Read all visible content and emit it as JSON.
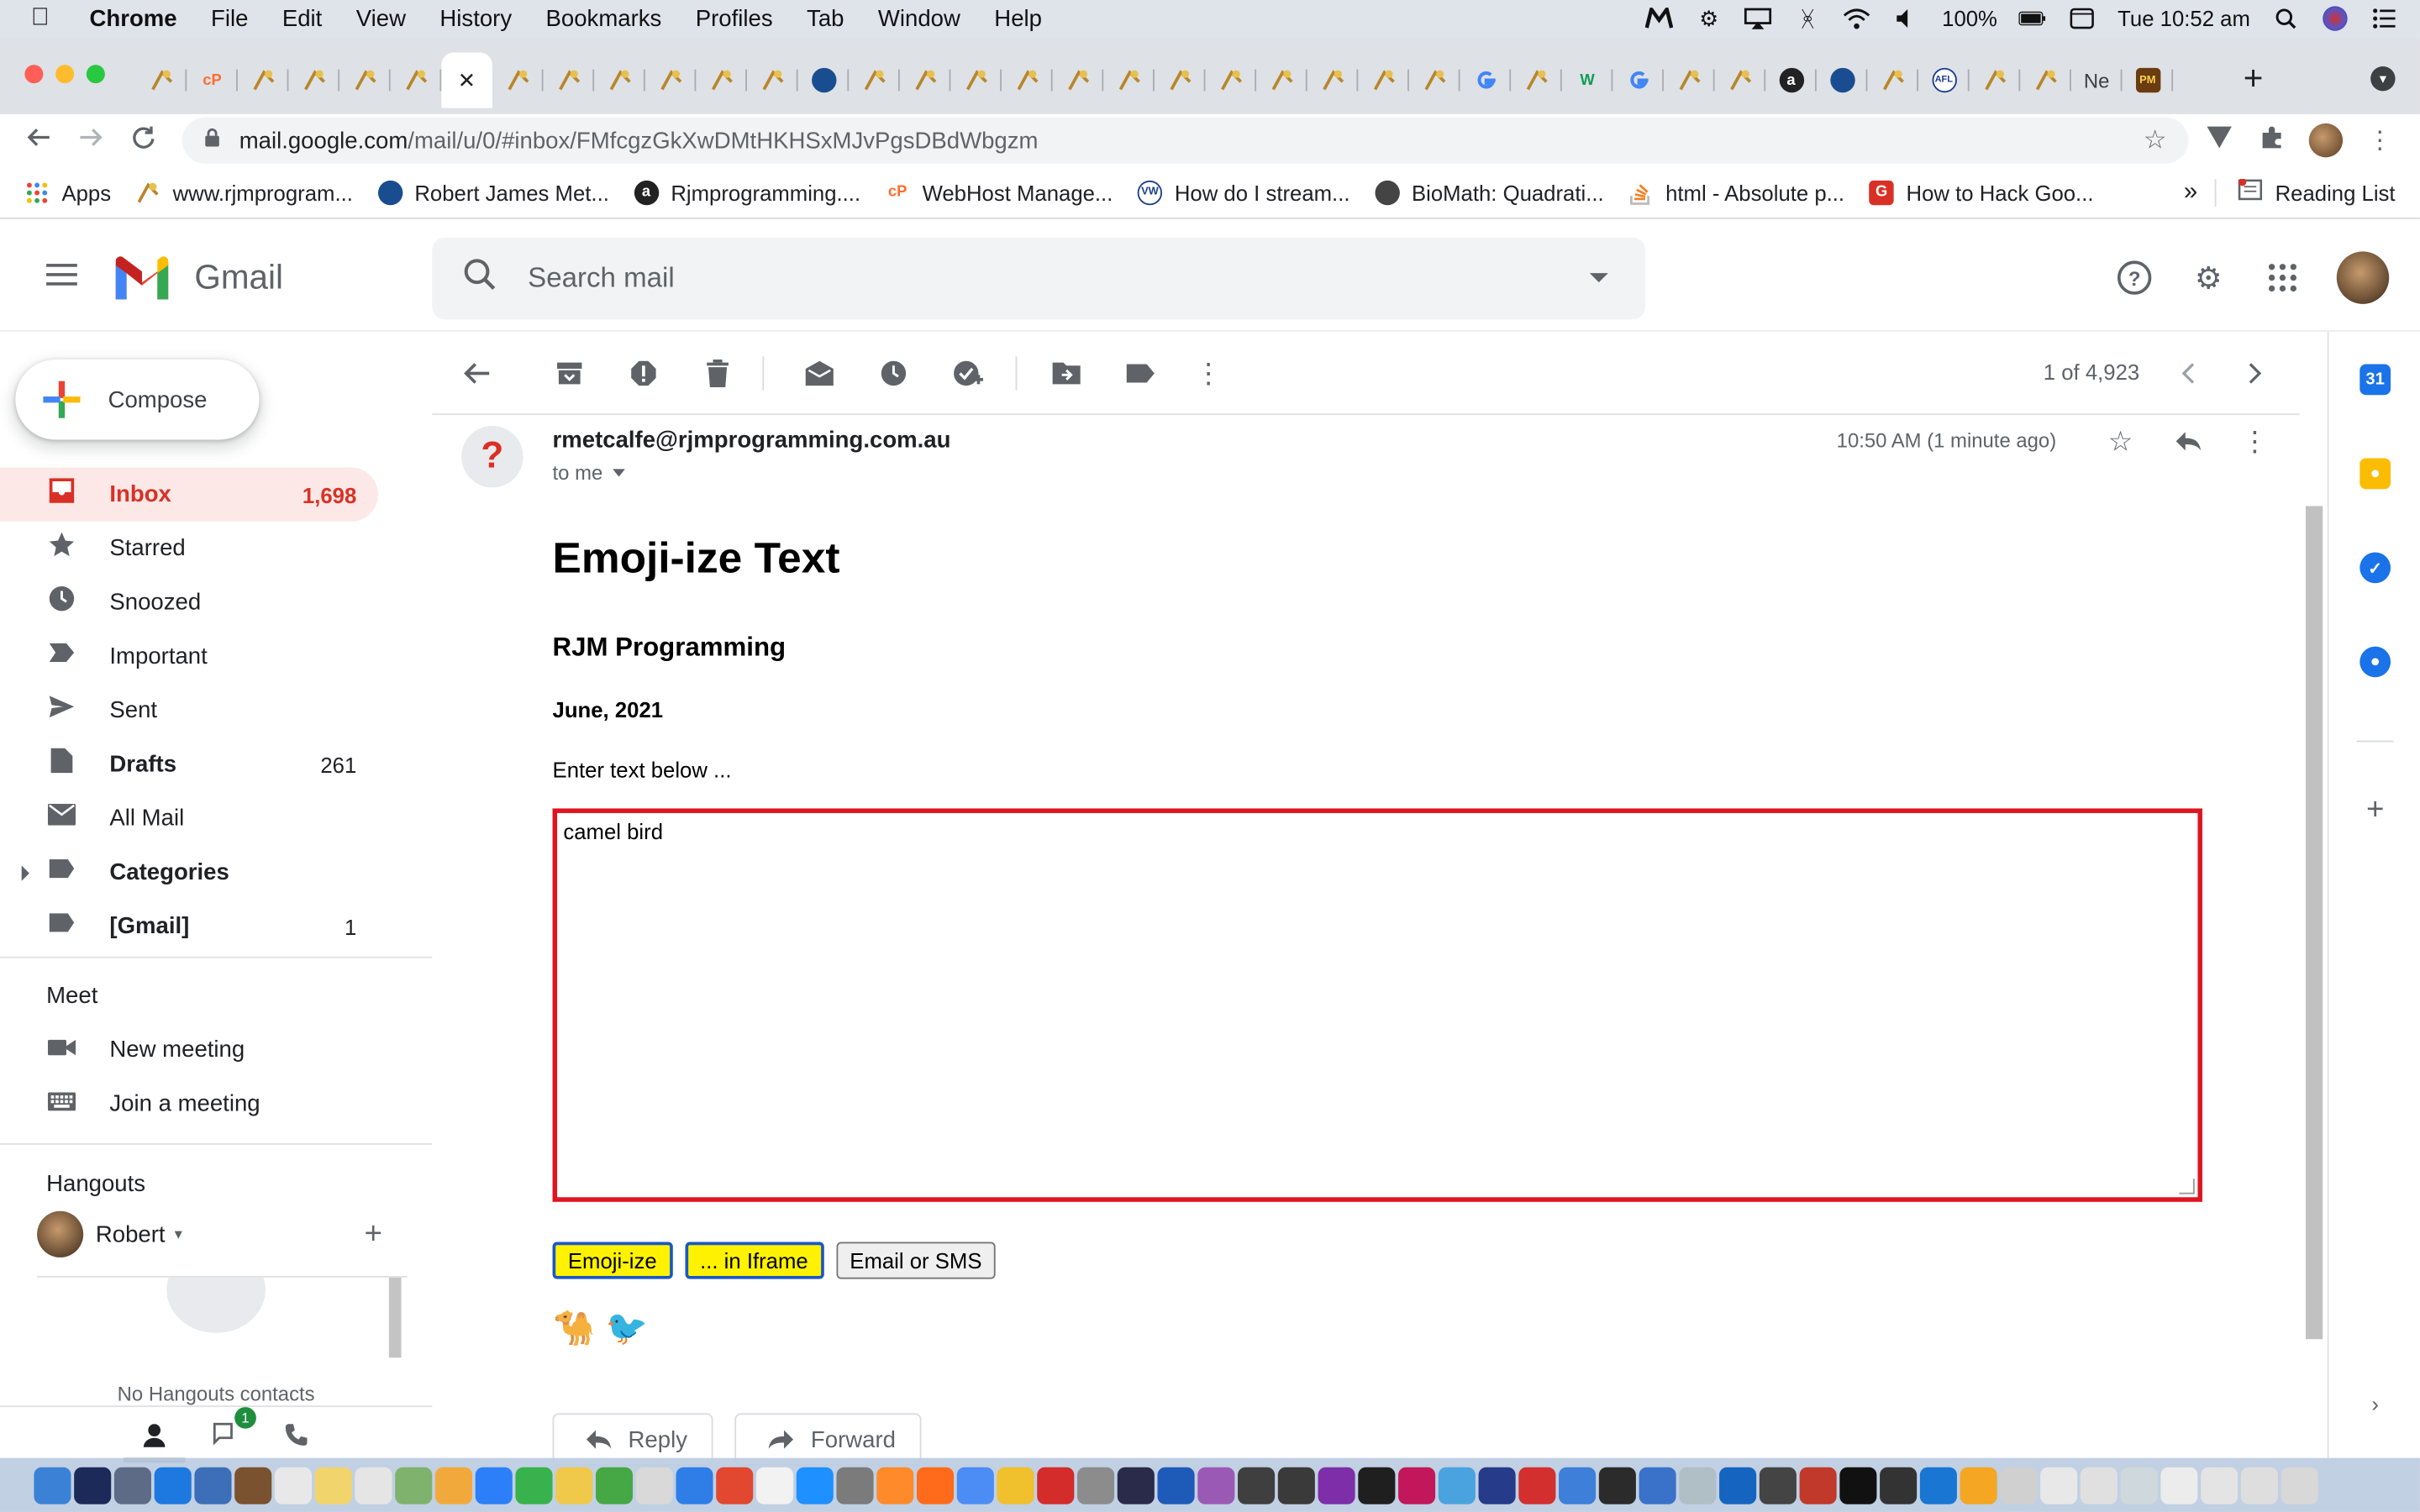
{
  "menubar": {
    "app": "Chrome",
    "menus": [
      "File",
      "Edit",
      "View",
      "History",
      "Bookmarks",
      "Profiles",
      "Tab",
      "Window",
      "Help"
    ],
    "battery": "100%",
    "clock": "Tue 10:52 am"
  },
  "browser": {
    "url_host": "mail.google.com",
    "url_path": "/mail/u/0/#inbox/FMfcgzGkXwDMtHKHSxMJvPgsDBdWbgzm",
    "new_tab_label": "+",
    "tab_partial_text": "Ne",
    "bookmarks": [
      {
        "label": "Apps",
        "icon": "apps-grid-icon",
        "color": "#4285f4"
      },
      {
        "label": "www.rjmprogram...",
        "icon": "rjm-icon",
        "color": "#c8a24a"
      },
      {
        "label": "Robert James Met...",
        "icon": "blue-circle-icon",
        "color": "#1a4d8f"
      },
      {
        "label": "Rjmprogramming....",
        "icon": "a-circle-icon",
        "color": "#222222"
      },
      {
        "label": "WebHost Manage...",
        "icon": "cpanel-icon",
        "color": "#ff6c2c"
      },
      {
        "label": "How do I stream...",
        "icon": "vw-icon",
        "color": "#1d3f8c"
      },
      {
        "label": "BioMath: Quadrati...",
        "icon": "globe-icon",
        "color": "#444444"
      },
      {
        "label": "html - Absolute p...",
        "icon": "stackoverflow-icon",
        "color": "#f48024"
      },
      {
        "label": "How to Hack Goo...",
        "icon": "g-red-icon",
        "color": "#d93025"
      }
    ],
    "more_bookmarks": "»",
    "reading_list": "Reading List"
  },
  "gmail": {
    "product": "Gmail",
    "search_placeholder": "Search mail",
    "compose": "Compose",
    "nav": [
      {
        "label": "Inbox",
        "count": "1,698",
        "icon": "inbox-icon",
        "active": true,
        "bold": true
      },
      {
        "label": "Starred",
        "count": "",
        "icon": "star-icon"
      },
      {
        "label": "Snoozed",
        "count": "",
        "icon": "clock-icon"
      },
      {
        "label": "Important",
        "count": "",
        "icon": "important-icon"
      },
      {
        "label": "Sent",
        "count": "",
        "icon": "send-icon"
      },
      {
        "label": "Drafts",
        "count": "261",
        "icon": "draft-icon",
        "bold": true
      },
      {
        "label": "All Mail",
        "count": "",
        "icon": "mail-icon"
      },
      {
        "label": "Categories",
        "count": "",
        "icon": "label-icon",
        "bold": true,
        "expandable": true
      },
      {
        "label": "[Gmail]",
        "count": "1",
        "icon": "label-icon",
        "bold": true
      }
    ],
    "meet": {
      "heading": "Meet",
      "new_meeting": "New meeting",
      "join_meeting": "Join a meeting"
    },
    "hangouts": {
      "heading": "Hangouts",
      "user": "Robert",
      "empty_text": "No Hangouts contacts",
      "chat_badge": "1"
    },
    "pager": "1 of 4,923"
  },
  "message": {
    "avatar_glyph": "?",
    "from": "rmetcalfe@rjmprogramming.com.au",
    "to": "to me",
    "time": "10:50 AM (1 minute ago)",
    "title": "Emoji-ize Text",
    "subtitle": "RJM Programming",
    "date": "June, 2021",
    "prompt": "Enter text below ...",
    "textarea_value": "camel bird",
    "buttons": [
      "Emoji-ize",
      "... in Iframe",
      "Email or SMS"
    ],
    "emojis": [
      "🐪",
      "🐦"
    ],
    "reply": "Reply",
    "forward": "Forward"
  },
  "colors": {
    "gmail_red": "#d93025",
    "textarea_border": "#e0141f",
    "yellow_button": "#fff200",
    "inbox_highlight": "#fce8e6"
  }
}
